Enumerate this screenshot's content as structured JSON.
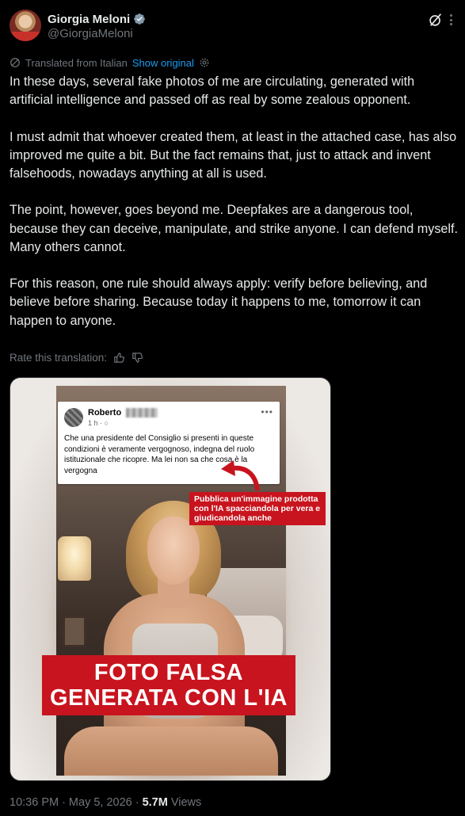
{
  "author": {
    "display_name": "Giorgia Meloni",
    "handle": "@GiorgiaMeloni",
    "verified_icon": "verified-badge-icon",
    "avatar_icon": "avatar"
  },
  "actions": {
    "grok_icon": "grok-icon",
    "more_icon": "more-options-icon"
  },
  "translation": {
    "label": "Translated from Italian",
    "show_original": "Show original",
    "rate_label": "Rate this translation:"
  },
  "post": {
    "paragraphs": [
      "In these days, several fake photos of me are circulating, generated with artificial intelligence and passed off as real by some zealous opponent.",
      "I must admit that whoever created them, at least in the attached case, has also improved me quite a bit. But the fact remains that, just to attack and invent falsehoods, nowadays anything at all is used.",
      "The point, however, goes beyond me. Deepfakes are a dangerous tool, because they can deceive, manipulate, and strike anyone. I can defend myself. Many others cannot.",
      "For this reason, one rule should always apply: verify before believing, and believe before sharing. Because today it happens to me, tomorrow it can happen to anyone."
    ]
  },
  "media": {
    "fb_post": {
      "name": "Roberto",
      "time": "1 h · ○",
      "dots": "•••",
      "text": "Che una presidente del Consiglio  si presenti in queste condizioni è veramente vergognoso, indegna del ruolo istituzionale che ricopre. Ma lei non sa che cosa è la vergogna"
    },
    "callout": "Pubblica un'immagine prodotta con l'IA spacciandola per vera e giudicandola anche",
    "banner_line1": "FOTO FALSA",
    "banner_line2": "GENERATA CON L'IA"
  },
  "meta": {
    "time": "10:36 PM",
    "date": "May 5, 2026",
    "views_count": "5.7M",
    "views_label": "Views",
    "separator": "·"
  },
  "colors": {
    "background": "#000000",
    "text": "#e7e9ea",
    "muted": "#71767b",
    "link": "#1d9bf0",
    "banner_red": "#c8141e"
  }
}
